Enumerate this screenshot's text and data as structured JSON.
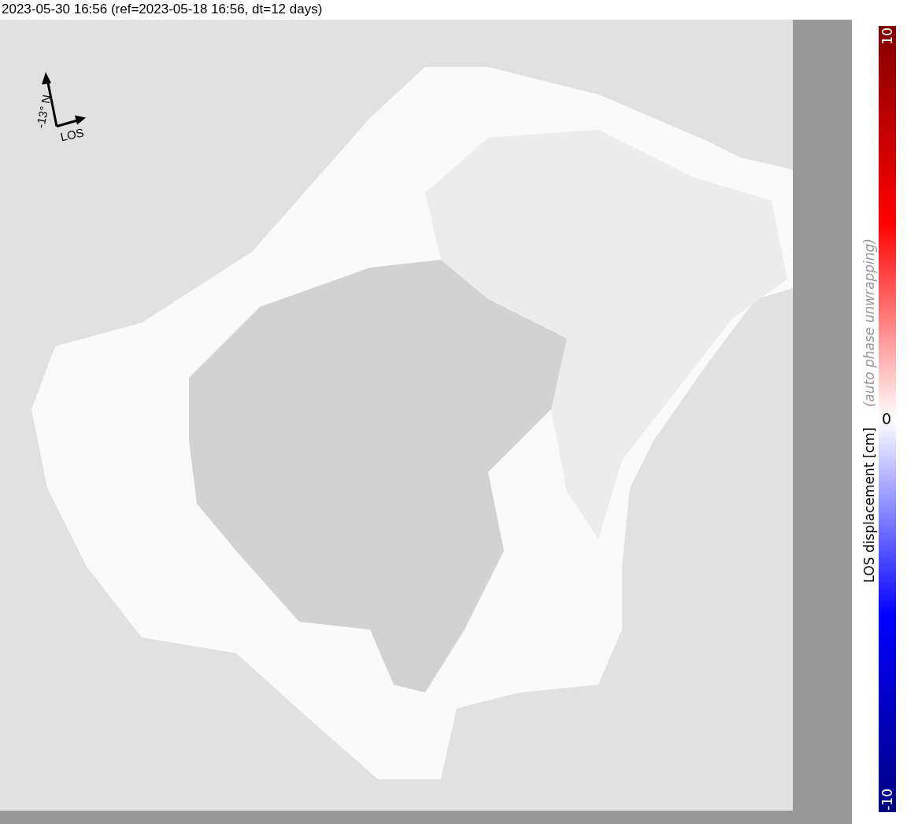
{
  "title": "2023-05-30 16:56 (ref=2023-05-18 16:56, dt=12 days)",
  "compass": {
    "north_label": "-13° N",
    "los_label": "LOS"
  },
  "colorbar": {
    "label": "LOS displacement [cm]",
    "note": "(auto phase unwrapping)",
    "max_label": "10",
    "mid_label": "0",
    "min_label": "-10"
  }
}
